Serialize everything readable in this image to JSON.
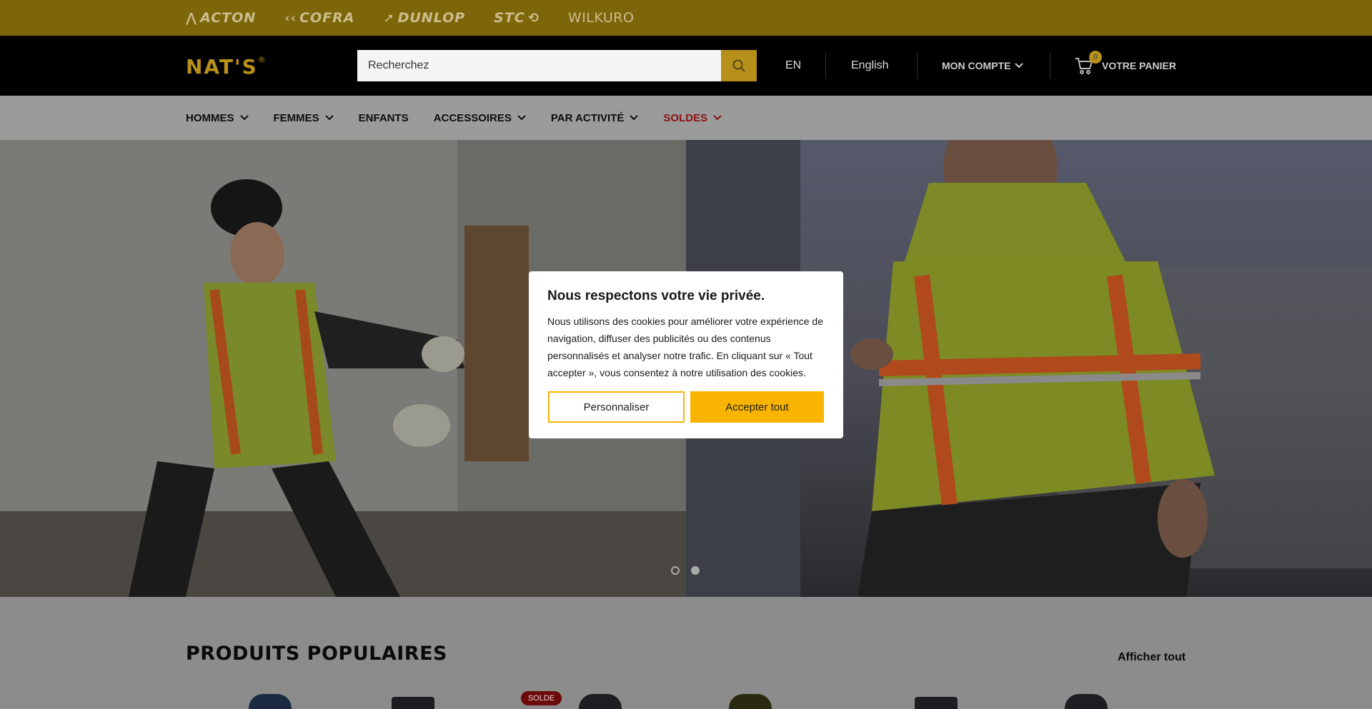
{
  "brands": [
    "ACTON",
    "COFRA",
    "DUNLOP",
    "STC",
    "WILKURO"
  ],
  "header": {
    "logo": "NAT'S",
    "logo_mark": "®",
    "search_placeholder": "Recherchez",
    "lang_code": "EN",
    "lang_name": "English",
    "account_label": "MON COMPTE",
    "cart_label": "VOTRE PANIER",
    "cart_count": "0"
  },
  "nav": {
    "items": [
      {
        "label": "HOMMES"
      },
      {
        "label": "FEMMES"
      },
      {
        "label": "ENFANTS"
      },
      {
        "label": "ACCESSOIRES"
      },
      {
        "label": "PAR ACTIVITÉ"
      },
      {
        "label": "SOLDES"
      }
    ]
  },
  "hero": {
    "slide_count": 2,
    "active_slide": 2
  },
  "section": {
    "title": "PRODUITS POPULAIRES",
    "see_all": "Afficher tout",
    "sale_badge": "SOLDE"
  },
  "cookie": {
    "title": "Nous respectons votre vie privée.",
    "body": "Nous utilisons des cookies pour améliorer votre expérience de navigation, diffuser des publicités ou des contenus personnalisés et analyser notre trafic. En cliquant sur « Tout accepter », vous consentez à notre utilisation des cookies.",
    "customize": "Personnaliser",
    "accept": "Accepter tout"
  },
  "colors": {
    "brand_gold": "#b7901c",
    "sale_red": "#8c1010",
    "accept_yellow": "#f8b400"
  }
}
